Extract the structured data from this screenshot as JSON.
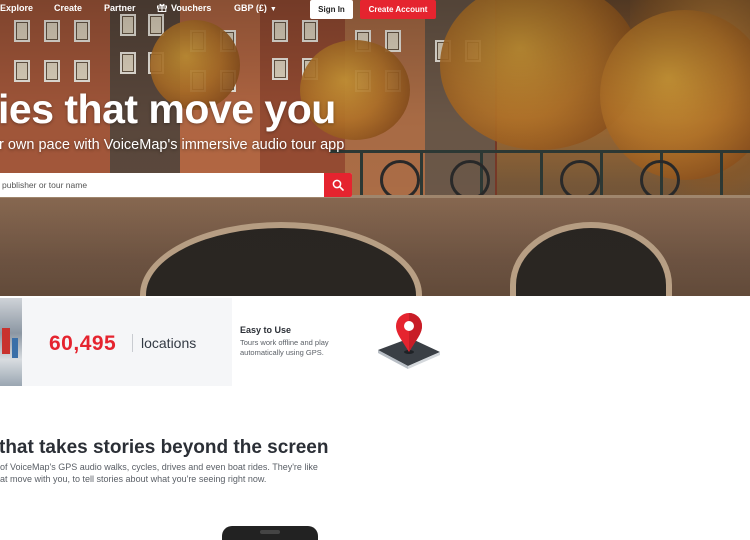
{
  "nav": {
    "explore": "Explore",
    "create": "Create",
    "partner": "Partner",
    "vouchers": "Vouchers",
    "currency": "GBP (£)",
    "sign_in": "Sign In",
    "create_account": "Create Account"
  },
  "hero": {
    "title": "ies that move you",
    "subtitle": "r own pace with VoiceMap's immersive audio tour app",
    "search_placeholder": "publisher or tour name"
  },
  "stats": {
    "count": "60,495",
    "label": "locations"
  },
  "feature": {
    "title": "Easy to Use",
    "description_line1": "Tours work offline and play",
    "description_line2": "automatically using GPS."
  },
  "section": {
    "title": "that takes stories beyond the screen",
    "body_line1": "of VoiceMap's GPS audio walks, cycles, drives and even boat rides. They're like",
    "body_line2": "at move with you, to tell stories about what you're seeing right now."
  },
  "icons": {
    "gift": "gift-icon",
    "caret": "caret-down-icon",
    "search": "search-icon",
    "map_pin": "map-pin-icon"
  },
  "colors": {
    "brand_red": "#e5242f",
    "text_dark": "#2b2f36",
    "card_bg": "#f5f6f8"
  }
}
